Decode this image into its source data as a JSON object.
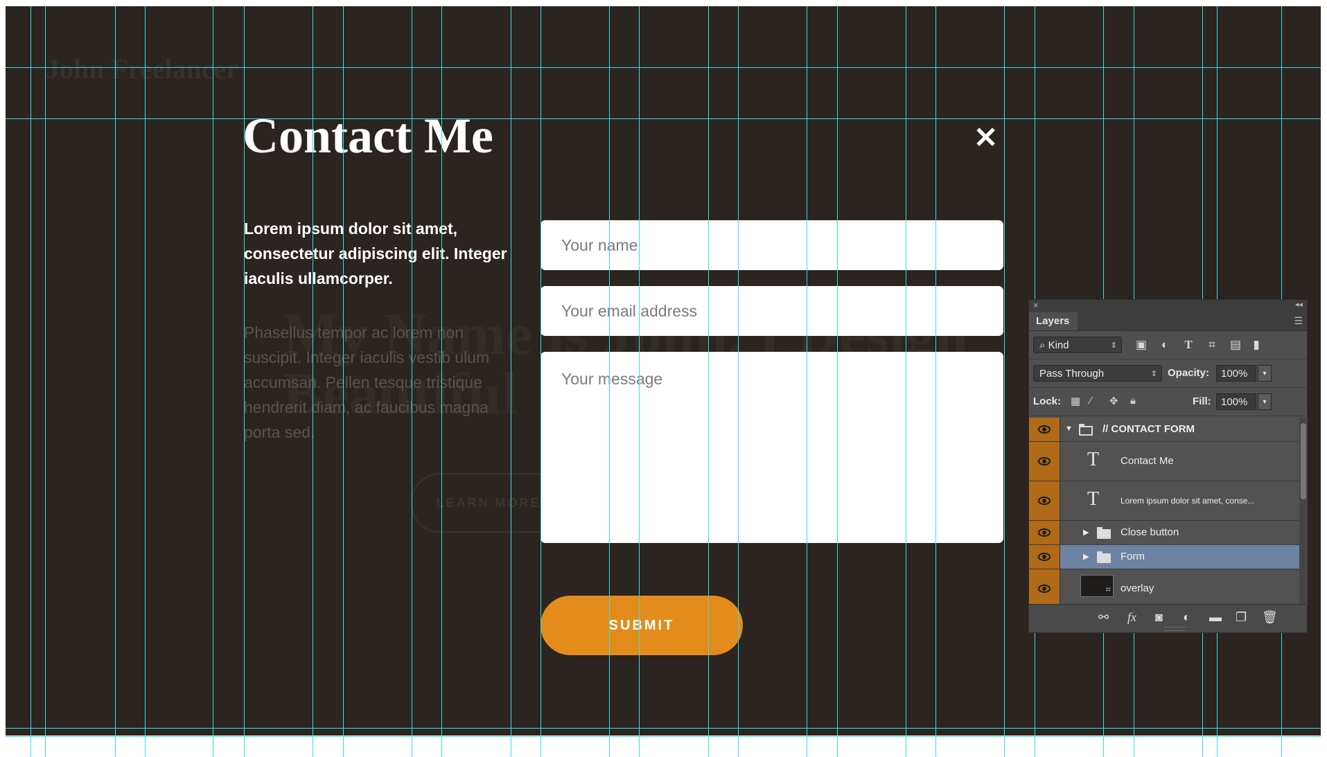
{
  "background": {
    "logo_text": "John Freelancer",
    "hero_text": "My Name is John. I Design Beautiful",
    "hero_button": "LEARN MORE"
  },
  "modal": {
    "title": "Contact Me",
    "close_glyph": "✕",
    "lead": "Lorem ipsum dolor sit amet, consectetur adipiscing elit. Integer iaculis ullamcorper.",
    "body": "Phasellus tempor ac lorem non suscipit. Integer iaculis vestib ulum accumsan. Pellen tesque tristique hendrerit diam, ac faucibus magna porta sed.",
    "fields": {
      "name_placeholder": "Your name",
      "email_placeholder": "Your email address",
      "message_placeholder": "Your message"
    },
    "submit_label": "SUBMIT",
    "accent_color": "#e38c1c"
  },
  "layers_panel": {
    "tab": "Layers",
    "filter_kind": "Kind",
    "blend_mode": "Pass Through",
    "opacity_label": "Opacity:",
    "opacity_value": "100%",
    "lock_label": "Lock:",
    "fill_label": "Fill:",
    "fill_value": "100%",
    "layers": [
      {
        "name": "// CONTACT FORM",
        "type": "group-open"
      },
      {
        "name": "Contact Me",
        "type": "text"
      },
      {
        "name": "Lorem ipsum dolor sit amet, conse...",
        "type": "text"
      },
      {
        "name": "Close button",
        "type": "group"
      },
      {
        "name": "Form",
        "type": "group",
        "selected": true
      },
      {
        "name": "overlay",
        "type": "shape"
      }
    ],
    "eye_color": "#b06a18",
    "selected_color": "#6d83a3"
  },
  "guides_color": "#35e0e0"
}
